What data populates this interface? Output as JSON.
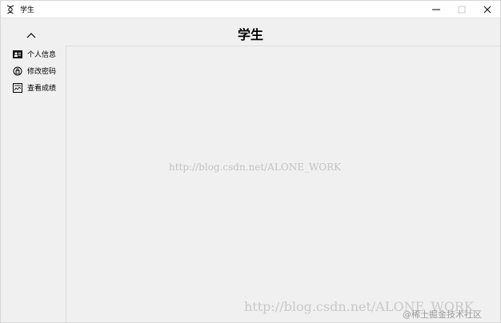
{
  "window": {
    "title": "学生"
  },
  "header": {
    "title": "学生"
  },
  "sidebar": {
    "items": [
      {
        "label": "个人信息",
        "icon": "id-card-icon"
      },
      {
        "label": "修改密码",
        "icon": "lock-icon"
      },
      {
        "label": "查看成绩",
        "icon": "score-sheet-icon"
      }
    ]
  },
  "watermarks": {
    "center": "http://blog.csdn.net/ALONE_WORK",
    "bottom_right": "http://blog.csdn.net/ALONE_WORK",
    "juejin": "@稀土掘金技术社区"
  },
  "colors": {
    "background": "#f0f0f0",
    "titlebar": "#ffffff",
    "border": "#dcdcdc"
  }
}
